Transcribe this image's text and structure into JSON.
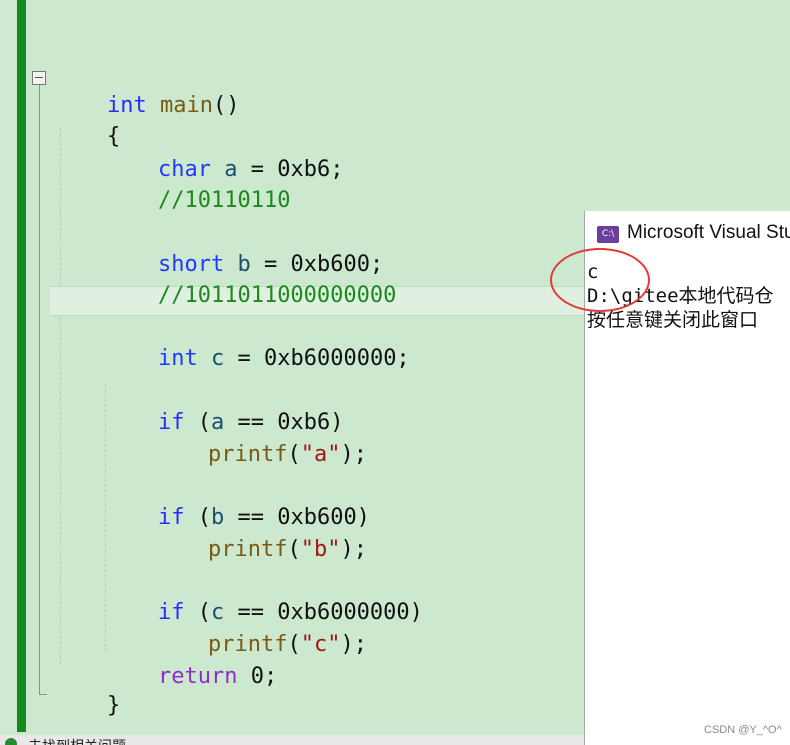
{
  "editor": {
    "lines": {
      "l1": {
        "kw": "int",
        "fn": "main",
        "rest": "()"
      },
      "l2": {
        "brace": "{"
      },
      "l3": {
        "type": "char",
        "var": "a",
        "op": " = ",
        "val": "0xb6;"
      },
      "l4": {
        "comment": "//10110110"
      },
      "l5": {
        "type": "short",
        "var": "b",
        "op": " = ",
        "val": "0xb600;"
      },
      "l6": {
        "comment": "//1011011000000000"
      },
      "l7": {
        "type": "int",
        "var": "c",
        "op": " = ",
        "val": "0xb6000000;"
      },
      "l8": {
        "kw": "if",
        "open": " (",
        "var": "a",
        "cond": " == 0xb6)"
      },
      "l9": {
        "fn": "printf",
        "open": "(",
        "str": "\"a\"",
        "close": ");"
      },
      "l10": {
        "kw": "if",
        "open": " (",
        "var": "b",
        "cond": " == 0xb600)"
      },
      "l11": {
        "fn": "printf",
        "open": "(",
        "str": "\"b\"",
        "close": ");"
      },
      "l12": {
        "kw": "if",
        "open": " (",
        "var": "c",
        "cond": " == 0xb6000000)"
      },
      "l13": {
        "fn": "printf",
        "open": "(",
        "str": "\"c\"",
        "close": ");"
      },
      "l14": {
        "kw": "return",
        "rest": " 0;"
      },
      "l15": {
        "brace": "}"
      }
    }
  },
  "console": {
    "icon_label": "C:\\",
    "title": "Microsoft Visual Stu",
    "output": [
      "c",
      "D:\\gitee本地代码仓",
      "按任意键关闭此窗口"
    ]
  },
  "statusbar": {
    "text": "未找到相关问题"
  },
  "watermark": "CSDN @Y_^O^",
  "colors": {
    "background": "#cce8cf",
    "change_bar": "#138a1d",
    "annotation_circle": "#e23b3b"
  }
}
